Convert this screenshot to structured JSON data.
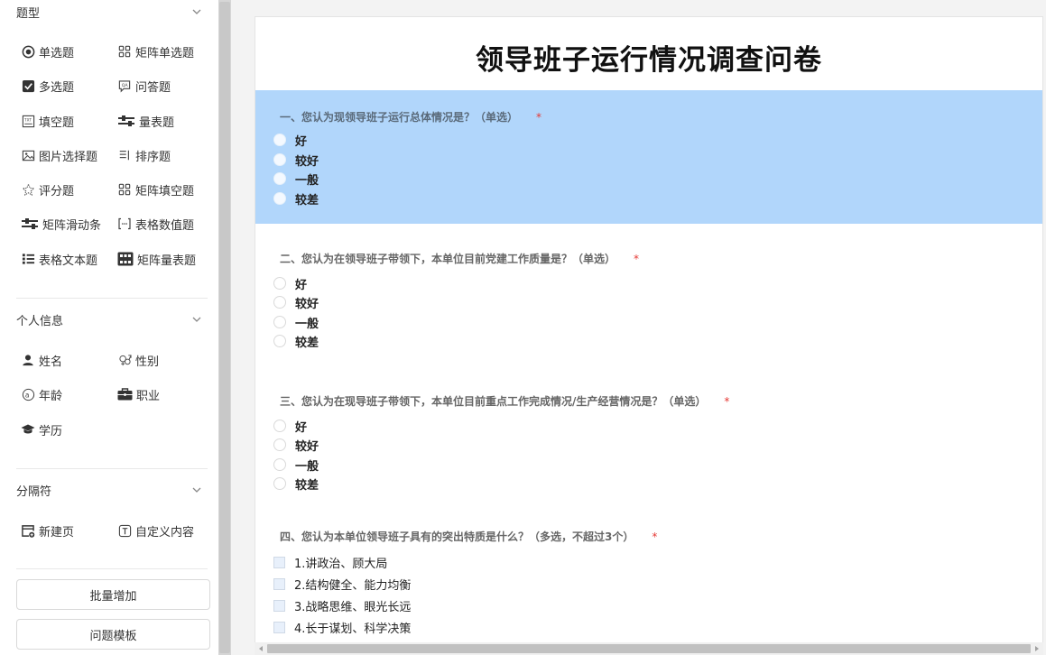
{
  "sidebar": {
    "sections": [
      {
        "title": "题型"
      },
      {
        "title": "个人信息"
      },
      {
        "title": "分隔符"
      }
    ],
    "question_types": [
      {
        "label": "单选题",
        "icon": "radio-icon"
      },
      {
        "label": "矩阵单选题",
        "icon": "grid-icon"
      },
      {
        "label": "多选题",
        "icon": "checkbox-icon"
      },
      {
        "label": "问答题",
        "icon": "qa-icon"
      },
      {
        "label": "填空题",
        "icon": "text-box-icon"
      },
      {
        "label": "量表题",
        "icon": "slider-icon"
      },
      {
        "label": "图片选择题",
        "icon": "image-icon"
      },
      {
        "label": "排序题",
        "icon": "sort-icon"
      },
      {
        "label": "评分题",
        "icon": "star-icon"
      },
      {
        "label": "矩阵填空题",
        "icon": "grid-icon"
      },
      {
        "label": "矩阵滑动条",
        "icon": "slider-icon"
      },
      {
        "label": "表格数值题",
        "icon": "bracket-icon"
      },
      {
        "label": "表格文本题",
        "icon": "list-icon"
      },
      {
        "label": "矩阵量表题",
        "icon": "matrix-scale-icon"
      }
    ],
    "personal_info": [
      {
        "label": "姓名",
        "icon": "user-icon"
      },
      {
        "label": "性别",
        "icon": "gender-icon"
      },
      {
        "label": "年龄",
        "icon": "at-icon"
      },
      {
        "label": "职业",
        "icon": "briefcase-icon"
      },
      {
        "label": "学历",
        "icon": "graduation-cap-icon"
      }
    ],
    "separators": [
      {
        "label": "新建页",
        "icon": "new-page-icon"
      },
      {
        "label": "自定义内容",
        "icon": "text-icon"
      }
    ],
    "buttons": {
      "batch_add": "批量增加",
      "question_template": "问题模板"
    }
  },
  "survey": {
    "title": "领导班子运行情况调查问卷",
    "required_mark": "*",
    "questions": [
      {
        "title": "一、您认为现领导班子运行总体情况是？（单选）",
        "type": "radio",
        "options": [
          "好",
          "较好",
          "一般",
          "较差"
        ]
      },
      {
        "title": "二、您认为在领导班子带领下，本单位目前党建工作质量是？（单选）",
        "type": "radio",
        "options": [
          "好",
          "较好",
          "一般",
          "较差"
        ]
      },
      {
        "title": "三、您认为在现导班子带领下，本单位目前重点工作完成情况/生产经营情况是？（单选）",
        "type": "radio",
        "options": [
          "好",
          "较好",
          "一般",
          "较差"
        ]
      },
      {
        "title": "四、您认为本单位领导班子具有的突出特质是什么？（多选，不超过3个）",
        "type": "checkbox",
        "options": [
          "1.讲政治、顾大局",
          "2.结构健全、能力均衡",
          "3.战略思维、眼光长远",
          "4.长于谋划、科学决策"
        ]
      }
    ]
  },
  "colors": {
    "active_question_bg": "#b1d6fb",
    "required": "#e53935",
    "canvas_bg": "#f3f3f3"
  }
}
